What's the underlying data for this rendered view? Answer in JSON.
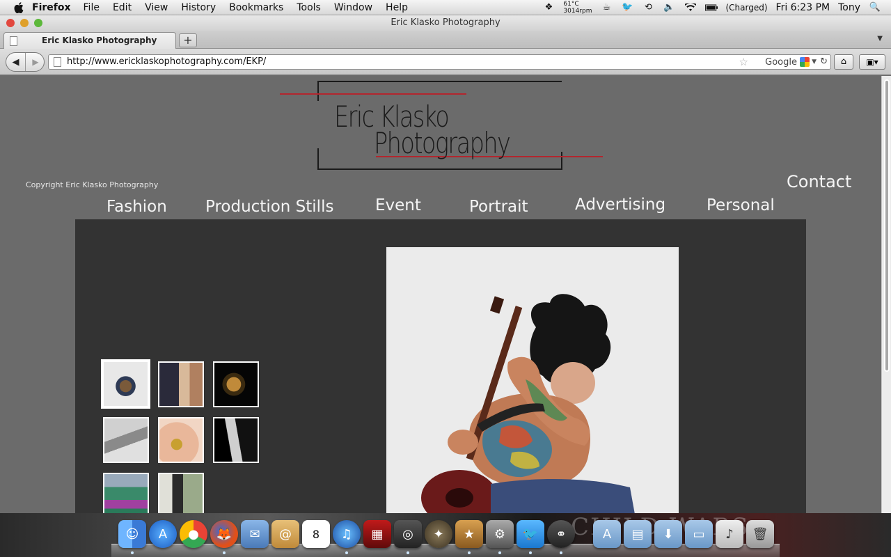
{
  "menubar": {
    "app_name": "Firefox",
    "items": [
      "File",
      "Edit",
      "View",
      "History",
      "Bookmarks",
      "Tools",
      "Window",
      "Help"
    ],
    "temp": "61°C",
    "fan": "3014rpm",
    "battery": "(Charged)",
    "clock": "Fri 6:23 PM",
    "user": "Tony"
  },
  "window": {
    "title": "Eric Klasko Photography"
  },
  "tab": {
    "label": "Eric Klasko Photography",
    "new_tab": "+"
  },
  "navbar": {
    "url": "http://www.ericklaskophotography.com/EKP/",
    "search_engine": "Google"
  },
  "page": {
    "logo_line1": "Eric Klasko",
    "logo_line2": "Photography",
    "copyright": "Copyright Eric Klasko Photography",
    "contact": "Contact",
    "nav": [
      "Fashion",
      "Production Stills",
      "Event",
      "Portrait",
      "Advertising",
      "Personal"
    ],
    "colors": {
      "page_bg": "#6b6b6b",
      "gallery_bg": "#333333",
      "logo_accent": "#b3262e"
    }
  },
  "dock": {
    "background_text": "CHILD WARS"
  }
}
